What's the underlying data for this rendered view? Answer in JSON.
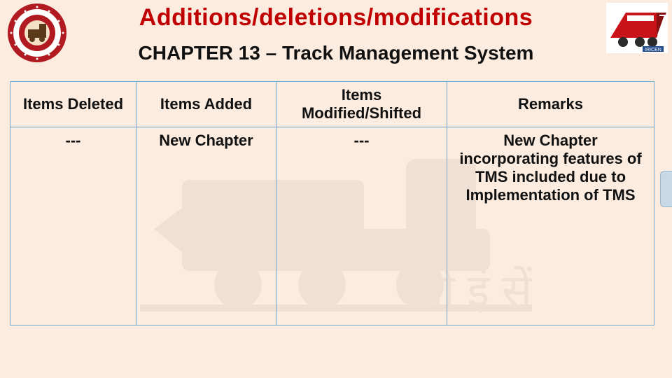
{
  "title": "Additions/deletions/modifications",
  "subtitle": "CHAPTER 13 – Track Management System",
  "logos": {
    "left_alt": "Indian Railways emblem",
    "right_alt": "IRICEN emblem"
  },
  "table": {
    "headers": [
      "Items Deleted",
      "Items Added",
      "Items Modified/Shifted",
      "Remarks"
    ],
    "rows": [
      {
        "deleted": "---",
        "added": "New Chapter",
        "modified": "---",
        "remarks": "New Chapter incorporating features of TMS included due to Implementation of TMS"
      }
    ]
  }
}
